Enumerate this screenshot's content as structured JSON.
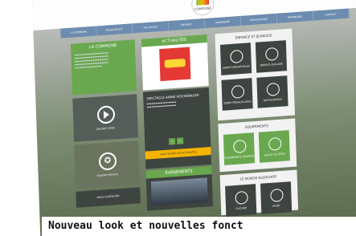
{
  "site": {
    "logo_text": "COMMUNE",
    "nav": [
      "LA COMMUNE",
      "MUNICIPALITÉ",
      "VIE LOCALE",
      "ENFANCE",
      "URBANISME",
      "ASSOCIATIONS",
      "PATRIMOINE",
      "CONTACT"
    ]
  },
  "left": {
    "commune_title": "LA COMMUNE",
    "video_label": "GALERIE VIDÉO",
    "photo_label": "GALERIE PHOTOS",
    "contact_label": "NOUS CONTACTER"
  },
  "middle": {
    "actualites_title": "ACTUALITÉS",
    "news_title": "SPECTACLE ANNIE ROCHENAUDY",
    "news_button": "VOIR TOUTES LES ACTUALITÉS",
    "evenements_title": "ÉVÈNEMENTS"
  },
  "right": {
    "enfance_title": "ENFANCE ET JEUNESSE",
    "enfance_items": [
      "ESPACE MÉDIATHÈQUE",
      "SERVICE SCOLAIRE",
      "TEMPS PÉRISCOLAIRES",
      "RESTAURATION"
    ],
    "equipements_title": "ÉQUIPEMENTS",
    "equipements_items": [
      "ÉQUIPEMENTS SPORTIFS",
      "SALLES DE FÊTES"
    ],
    "asso_title": "LE MONDE ASSOCIATIF",
    "asso_items": [
      "CULTURE",
      "SPORT"
    ]
  },
  "caption": "Nouveau look et nouvelles fonct",
  "colors": {
    "green": "#6aa84f",
    "dark": "#3e4540",
    "nav": "#6c8cb0"
  }
}
